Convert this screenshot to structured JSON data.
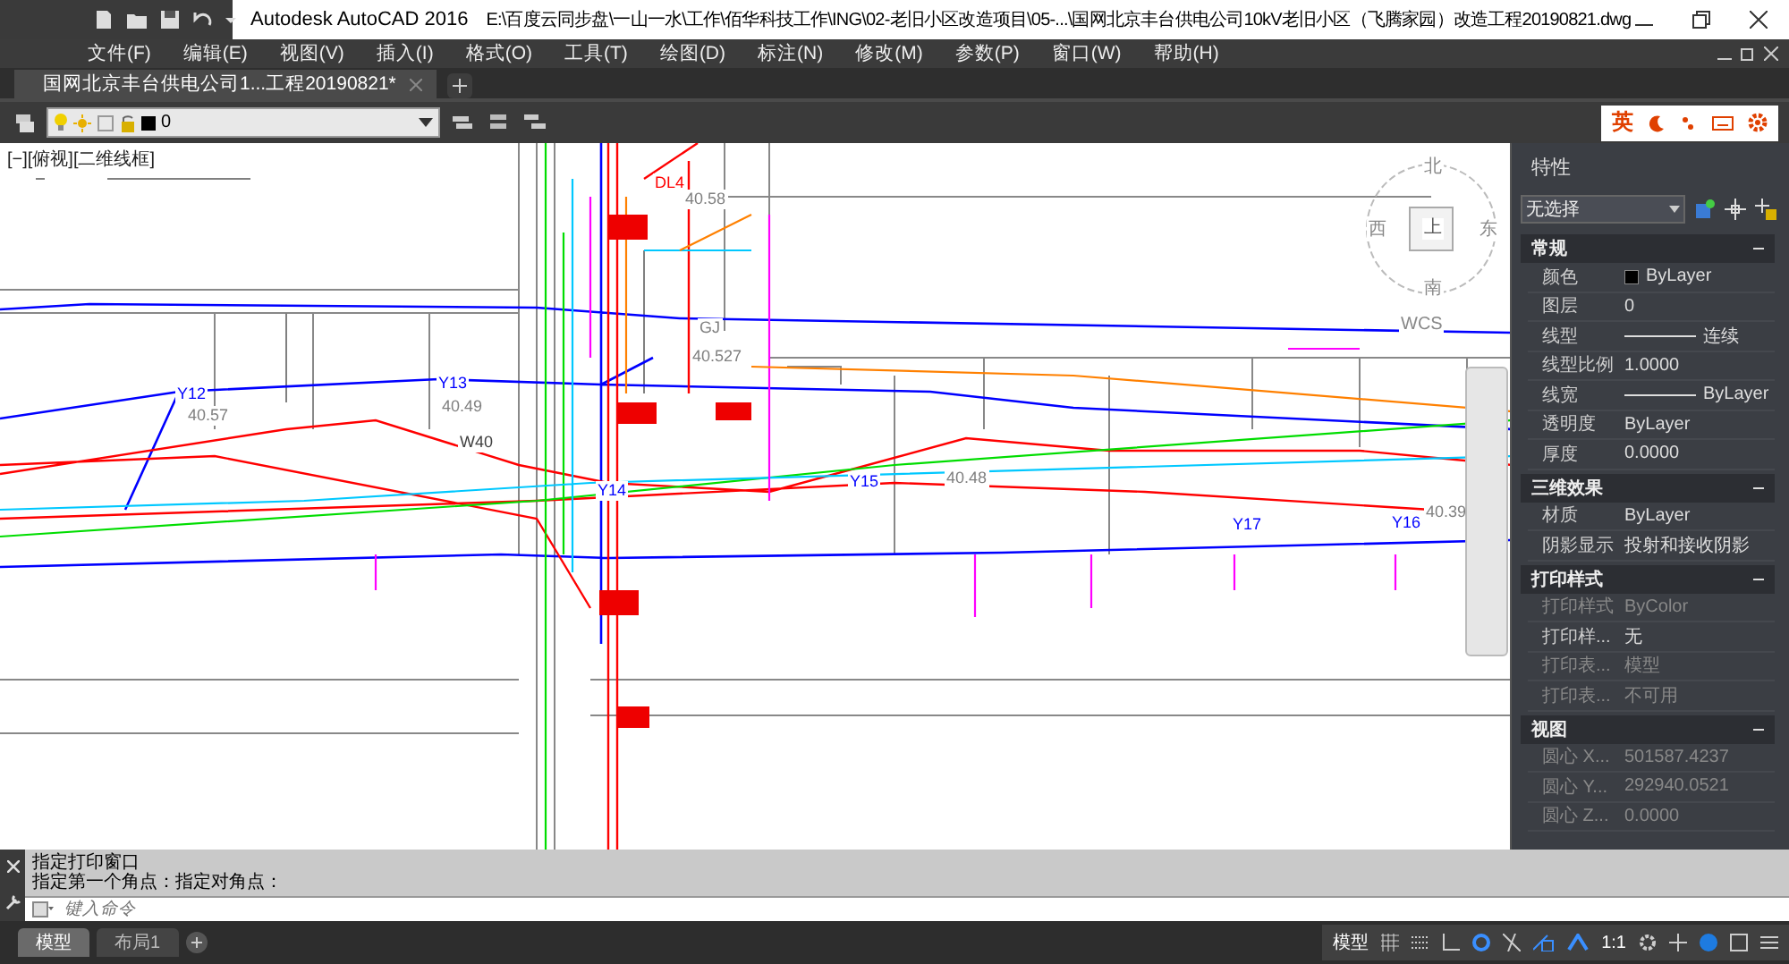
{
  "title_bar": {
    "app_title": "Autodesk AutoCAD 2016",
    "file_path": "E:\\百度云同步盘\\一山一水\\工作\\佰华科技工作\\ING\\02-老旧小区改造项目\\05-...\\国网北京丰台供电公司10kV老旧小区（飞腾家园）改造工程20190821.dwg"
  },
  "menu": [
    "文件(F)",
    "编辑(E)",
    "视图(V)",
    "插入(I)",
    "格式(O)",
    "工具(T)",
    "绘图(D)",
    "标注(N)",
    "修改(M)",
    "参数(P)",
    "窗口(W)",
    "帮助(H)"
  ],
  "doc_tabs": [
    {
      "label": "国网北京丰台供电公司1...工程20190821*",
      "selected": true
    }
  ],
  "layer_toolbar": {
    "layer": "0"
  },
  "ime_bar": {
    "mode": "英"
  },
  "viewport": {
    "label": "[−][俯视][二维线框]",
    "compass": {
      "north": "北",
      "west": "西",
      "top": "上",
      "east": "东",
      "south": "南",
      "ucs": "WCS"
    },
    "labels": [
      {
        "text": "DL4",
        "color": "#ff0000"
      },
      {
        "text": "40.58",
        "color": "#808080"
      },
      {
        "text": "GJ",
        "color": "#808080"
      },
      {
        "text": "40.527",
        "color": "#808080"
      },
      {
        "text": "Y12",
        "color": "#0000ff"
      },
      {
        "text": "40.57",
        "color": "#808080"
      },
      {
        "text": "Y13",
        "color": "#0000ff"
      },
      {
        "text": "40.49",
        "color": "#808080"
      },
      {
        "text": "W40",
        "color": "#404040"
      },
      {
        "text": "Y14",
        "color": "#0000ff"
      },
      {
        "text": "Y15",
        "color": "#0000ff"
      },
      {
        "text": "40.48",
        "color": "#808080"
      },
      {
        "text": "Y17",
        "color": "#0000ff"
      },
      {
        "text": "Y16",
        "color": "#0000ff"
      },
      {
        "text": "40.39",
        "color": "#808080"
      }
    ]
  },
  "properties": {
    "title": "特性",
    "selection": "无选择",
    "sections": [
      {
        "title": "常规",
        "expanded": true,
        "rows": [
          {
            "name": "颜色",
            "value": "ByLayer",
            "kind": "color",
            "disabled": false
          },
          {
            "name": "图层",
            "value": "0",
            "kind": "text",
            "disabled": false
          },
          {
            "name": "线型",
            "value": "连续",
            "kind": "linetype",
            "disabled": false
          },
          {
            "name": "线型比例",
            "value": "1.0000",
            "kind": "text",
            "disabled": false
          },
          {
            "name": "线宽",
            "value": "ByLayer",
            "kind": "linetype",
            "disabled": false
          },
          {
            "name": "透明度",
            "value": "ByLayer",
            "kind": "text",
            "disabled": false
          },
          {
            "name": "厚度",
            "value": "0.0000",
            "kind": "text",
            "disabled": false
          }
        ]
      },
      {
        "title": "三维效果",
        "expanded": true,
        "rows": [
          {
            "name": "材质",
            "value": "ByLayer",
            "kind": "text",
            "disabled": false
          },
          {
            "name": "阴影显示",
            "value": "投射和接收阴影",
            "kind": "text",
            "disabled": false
          }
        ]
      },
      {
        "title": "打印样式",
        "expanded": true,
        "rows": [
          {
            "name": "打印样式",
            "value": "ByColor",
            "kind": "text",
            "disabled": true
          },
          {
            "name": "打印样...",
            "value": "无",
            "kind": "text",
            "disabled": false
          },
          {
            "name": "打印表...",
            "value": "模型",
            "kind": "text",
            "disabled": true
          },
          {
            "name": "打印表...",
            "value": "不可用",
            "kind": "text",
            "disabled": true
          }
        ]
      },
      {
        "title": "视图",
        "expanded": true,
        "rows": [
          {
            "name": "圆心 X...",
            "value": "501587.4237",
            "kind": "text",
            "disabled": true
          },
          {
            "name": "圆心 Y...",
            "value": "292940.0521",
            "kind": "text",
            "disabled": true
          },
          {
            "name": "圆心 Z...",
            "value": "0.0000",
            "kind": "text",
            "disabled": true
          }
        ]
      }
    ]
  },
  "command_line": {
    "history": [
      "指定打印窗口",
      "指定第一个角点：指定对角点："
    ],
    "placeholder": "键入命令"
  },
  "layout_tabs": [
    {
      "label": "模型",
      "selected": true
    },
    {
      "label": "布局1",
      "selected": false
    }
  ],
  "status_bar": {
    "space": "模型",
    "scale": "1:1"
  }
}
